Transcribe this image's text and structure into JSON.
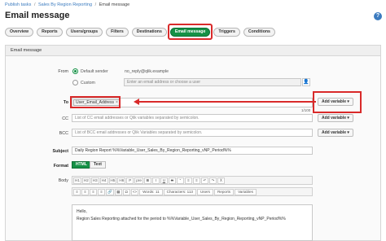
{
  "breadcrumb": {
    "items": [
      "Publish tasks",
      "Sales By Region Reporting",
      "Email message"
    ],
    "separator": "/"
  },
  "page": {
    "title": "Email message",
    "help_glyph": "?"
  },
  "tabs": [
    {
      "label": "Overview",
      "active": false
    },
    {
      "label": "Reports",
      "active": false
    },
    {
      "label": "Users/groups",
      "active": false
    },
    {
      "label": "Filters",
      "active": false
    },
    {
      "label": "Destinations",
      "active": false
    },
    {
      "label": "Email message",
      "active": true
    },
    {
      "label": "Triggers",
      "active": false
    },
    {
      "label": "Conditions",
      "active": false
    }
  ],
  "panel": {
    "title": "Email message"
  },
  "from": {
    "label": "From",
    "default_label": "Default sender",
    "default_value": "no_reply@qlik.example",
    "custom_label": "Custom",
    "custom_placeholder": "Enter an email address or choose a user",
    "selected": "default"
  },
  "to": {
    "label": "To",
    "token": "User_Email_Address",
    "token_remove": "×",
    "counter": "1/100",
    "add_variable_label": "Add variable ▾"
  },
  "cc": {
    "label": "CC",
    "placeholder": "List of CC email addresses or Qlik variables separated by semicolon.",
    "add_variable_label": "Add variable ▾"
  },
  "bcc": {
    "label": "BCC",
    "placeholder": "List of BCC email addresses or Qlik Variables separated by semicolon.",
    "add_variable_label": "Add variable ▾"
  },
  "subject": {
    "label": "Subject",
    "value": "Daily Region Report %%Variable_User_Sales_By_Region_Reporting_vNP_Period%%"
  },
  "format": {
    "label": "Format",
    "options": [
      "HTML",
      "Text"
    ],
    "selected": "HTML"
  },
  "body": {
    "label": "Body",
    "toolbar_row1": [
      "H1",
      "H2",
      "H3",
      "H4",
      "H5",
      "H6",
      "P",
      "pre",
      "B",
      "I",
      "U",
      "S",
      "\"",
      "≡",
      "≡",
      "↶",
      "↷",
      "Ⅹ"
    ],
    "toolbar_row2": {
      "align": [
        "≡",
        "≡",
        "≡",
        "≡"
      ],
      "misc": [
        "🔗",
        "▦",
        "Ω",
        "<>"
      ],
      "words": "Words: 11",
      "characters": "Characters: 113",
      "users": "Users",
      "reports": "Reports",
      "variables": "Variables"
    },
    "greeting": "Hello,",
    "content": "Region Sales Reporting attached for the period to %%Variable_User_Sales_By_Region_Reporting_vNP_Period%%"
  },
  "colors": {
    "accent": "#159146",
    "highlight": "#d92a2a",
    "link": "#3b7bbf"
  }
}
